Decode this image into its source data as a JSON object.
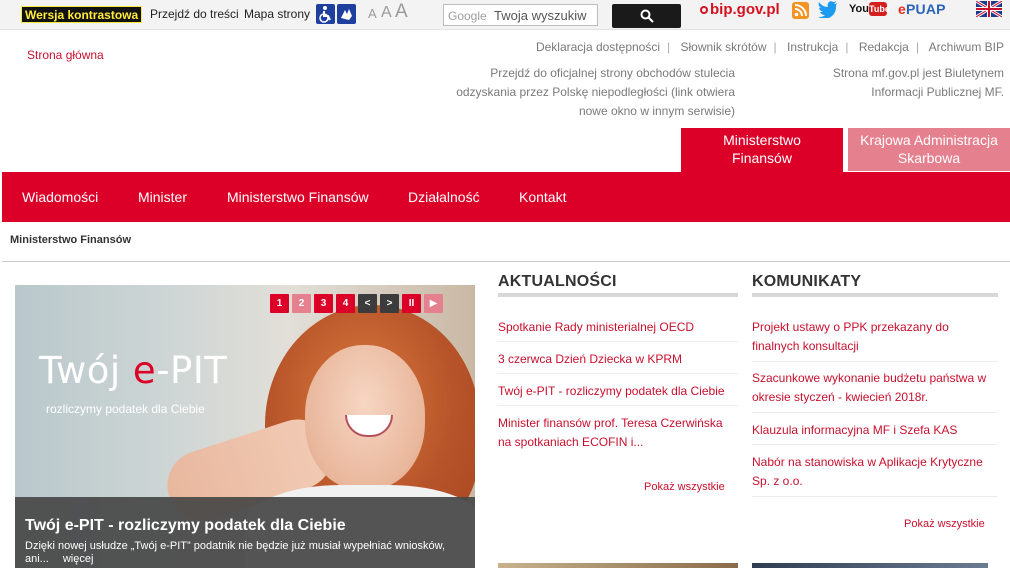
{
  "topbar": {
    "contrast_label": "Wersja kontrastowa",
    "skip_to_content": "Przejdź do treści",
    "sitemap": "Mapa strony",
    "font_sizes": [
      "A",
      "A",
      "A"
    ],
    "search_brand": "Google",
    "search_value": "Twoja wyszukiw",
    "bip_label": "bip.gov.pl",
    "youtube_you": "You",
    "youtube_tube": "Tube",
    "epuap_e": "e",
    "epuap_rest": "PUAP",
    "icons": [
      "wheelchair-icon",
      "sign-language-icon",
      "search-icon",
      "rss-icon",
      "twitter-icon",
      "youtube-icon",
      "english-flag-icon"
    ]
  },
  "header": {
    "home_link": "Strona główna",
    "links": [
      "Deklaracja dostępności",
      "Słownik skrótów",
      "Instrukcja",
      "Redakcja",
      "Archiwum BIP"
    ],
    "centenary_text": [
      "Przejdź do oficjalnej strony obchodów stulecia",
      "odzyskania przez Polskę niepodległości (link otwiera",
      "nowe okno w innym serwisie)"
    ],
    "bip_text": [
      "Strona mf.gov.pl jest Biuletynem",
      "Informacji Publicznej MF."
    ],
    "tabs": [
      {
        "line1": "Ministerstwo",
        "line2": "Finansów"
      },
      {
        "line1": "Krajowa Administracja",
        "line2": "Skarbowa"
      }
    ],
    "accent_color": "#dc0029",
    "accent_light": "#e5808e"
  },
  "nav": {
    "items": [
      "Wiadomości",
      "Minister",
      "Ministerstwo Finansów",
      "Działalność",
      "Kontakt"
    ]
  },
  "breadcrumb": "Ministerstwo Finansów",
  "slider": {
    "headline_prefix": "Twój ",
    "headline_e": "e",
    "headline_suffix": "-PIT",
    "subtitle": "rozliczymy podatek dla Ciebie",
    "caption_title": "Twój e-PIT - rozliczymy podatek dla Ciebie",
    "caption_text": "Dzięki nowej usłudze „Twój e-PIT” podatnik nie będzie już musiał wypełniać wniosków, ani...",
    "caption_more": "więcej",
    "pager": [
      "1",
      "2",
      "3",
      "4",
      "<",
      ">",
      "II",
      "▶"
    ]
  },
  "news": {
    "title": "AKTUALNOŚCI",
    "items": [
      "Spotkanie Rady ministerialnej OECD",
      "3 czerwca Dzień Dziecka w KPRM",
      "Twój e-PIT - rozliczymy podatek dla Ciebie",
      "Minister finansów prof. Teresa Czerwińska na spotkaniach ECOFIN i..."
    ],
    "show_all": "Pokaż wszystkie"
  },
  "announcements": {
    "title": "KOMUNIKATY",
    "items": [
      "Projekt ustawy o PPK przekazany do finalnych konsultacji",
      "Szacunkowe wykonanie budżetu państwa w okresie styczeń - kwiecień 2018r.",
      "Klauzula informacyjna MF i Szefa KAS",
      "Nabór na stanowiska w Aplikacje Krytyczne Sp. z o.o."
    ],
    "show_all": "Pokaż wszystkie"
  }
}
